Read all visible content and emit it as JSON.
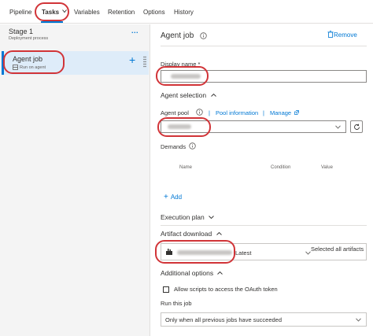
{
  "nav": {
    "pipeline": "Pipeline",
    "tasks": "Tasks",
    "variables": "Variables",
    "retention": "Retention",
    "options": "Options",
    "history": "History"
  },
  "stage": {
    "title": "Stage 1",
    "subtitle": "Deployment process",
    "more": "..."
  },
  "job": {
    "name": "Agent job",
    "subtitle": "Run on agent"
  },
  "panel": {
    "title": "Agent job",
    "remove_label": "Remove",
    "display_name_label": "Display name *",
    "display_name_value": "",
    "agent_selection": "Agent selection",
    "agent_pool_label": "Agent pool",
    "pool_information": "Pool information",
    "separator": "|",
    "manage": "Manage",
    "agent_pool_value": "",
    "demands_label": "Demands",
    "demands_columns": [
      "Name",
      "Condition",
      "Value"
    ],
    "add_label": "Add",
    "execution_plan": "Execution plan",
    "artifact_download": "Artifact download",
    "artifact_version": "Latest",
    "artifact_selection": "Selected all artifacts",
    "additional_options": "Additional options",
    "allow_scripts": "Allow scripts to access the OAuth token",
    "run_this_job_label": "Run this job",
    "run_this_job_value": "Only when all previous jobs have succeeded"
  },
  "colors": {
    "accent": "#0078d4",
    "annotation": "#d13438",
    "selected_bg": "#deecf9"
  }
}
